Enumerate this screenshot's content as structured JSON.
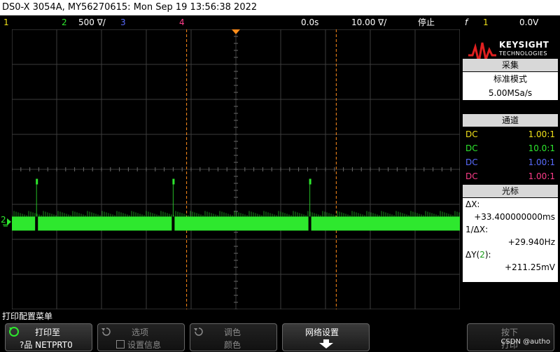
{
  "title": "DS0-X 3054A, MY56270615: Mon Sep 19 13:56:38 2022",
  "status_bar": {
    "ch1": "1",
    "ch2": "2",
    "ch2_scale": "500 ∇/",
    "ch3": "3",
    "ch4": "4",
    "delay": "0.0s",
    "timebase": "10.00 ∇/",
    "run_state": "停止",
    "trigger_symbol": "f",
    "trigger_channel": "1",
    "trigger_level": "0.0V"
  },
  "logo": {
    "brand": "KEYSIGHT",
    "sub": "TECHNOLOGIES"
  },
  "acquire": {
    "header": "采集",
    "mode": "标准模式",
    "rate": "5.00MSa/s"
  },
  "channels": {
    "header": "通道",
    "rows": [
      {
        "coupling": "DC",
        "probe": "1.00:1",
        "color": "#f2e21a"
      },
      {
        "coupling": "DC",
        "probe": "10.0:1",
        "color": "#2ee82e"
      },
      {
        "coupling": "DC",
        "probe": "1.00:1",
        "color": "#5a6cff"
      },
      {
        "coupling": "DC",
        "probe": "1.00:1",
        "color": "#ff3d8a"
      }
    ]
  },
  "cursors": {
    "header": "光标",
    "dx_label": "ΔX:",
    "dx_value": "+33.400000000ms",
    "inv_dx_label": "1/ΔX:",
    "inv_dx_value": "+29.940Hz",
    "dy_label_pre": "ΔY(",
    "dy_channel": "2",
    "dy_label_post": "):",
    "dy_value": "+211.25mV"
  },
  "ground_marker": "2",
  "menu_title": "打印配置菜单",
  "softkeys": {
    "print_to_label": "打印至",
    "print_to_value": "?品 NETPRT0",
    "options_label": "选项",
    "options_sub": "设置信息",
    "palette_label": "调色",
    "palette_sub": "颜色",
    "network_label": "网络设置",
    "press_label": "按下",
    "press_sub": "打印"
  },
  "watermark": "CSDN @autho",
  "colors": {
    "ch1": "#f2e21a",
    "ch2": "#2ee82e",
    "ch3": "#5a6cff",
    "ch4": "#ff3d8a",
    "cursor": "#ff8c1a",
    "trigger_marker": "#ff8c1a"
  },
  "waveform": {
    "channel": "2",
    "baseline_level": "low",
    "pulse_times_divisions": [
      0.55,
      3.6,
      6.65
    ],
    "description_level": "pulses"
  }
}
